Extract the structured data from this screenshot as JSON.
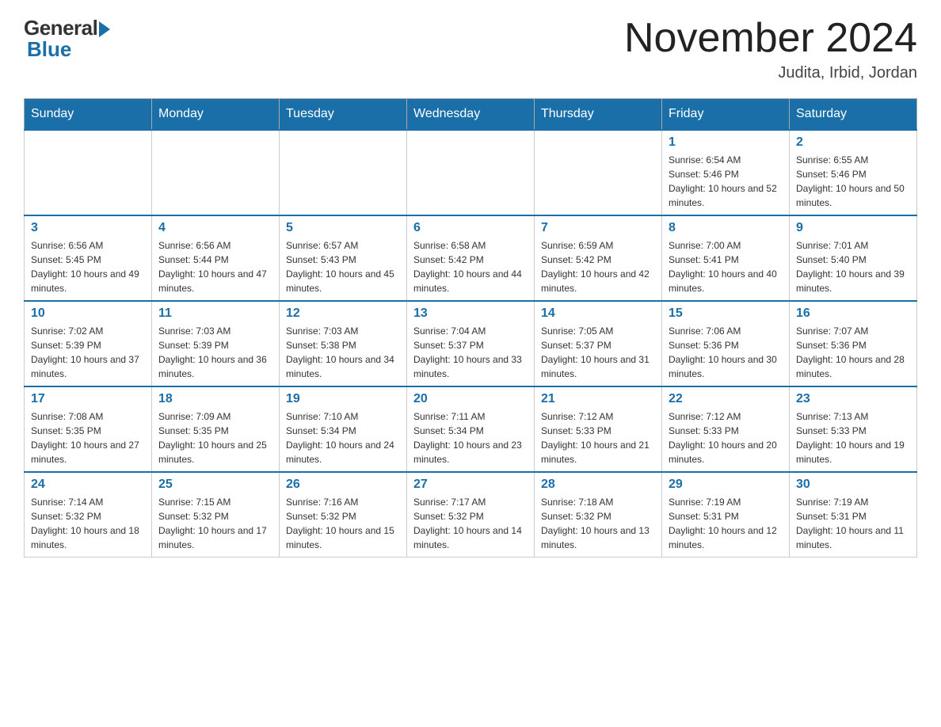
{
  "header": {
    "logo_general": "General",
    "logo_blue": "Blue",
    "month_title": "November 2024",
    "location": "Judita, Irbid, Jordan"
  },
  "weekdays": [
    "Sunday",
    "Monday",
    "Tuesday",
    "Wednesday",
    "Thursday",
    "Friday",
    "Saturday"
  ],
  "weeks": [
    [
      {
        "day": "",
        "sunrise": "",
        "sunset": "",
        "daylight": ""
      },
      {
        "day": "",
        "sunrise": "",
        "sunset": "",
        "daylight": ""
      },
      {
        "day": "",
        "sunrise": "",
        "sunset": "",
        "daylight": ""
      },
      {
        "day": "",
        "sunrise": "",
        "sunset": "",
        "daylight": ""
      },
      {
        "day": "",
        "sunrise": "",
        "sunset": "",
        "daylight": ""
      },
      {
        "day": "1",
        "sunrise": "Sunrise: 6:54 AM",
        "sunset": "Sunset: 5:46 PM",
        "daylight": "Daylight: 10 hours and 52 minutes."
      },
      {
        "day": "2",
        "sunrise": "Sunrise: 6:55 AM",
        "sunset": "Sunset: 5:46 PM",
        "daylight": "Daylight: 10 hours and 50 minutes."
      }
    ],
    [
      {
        "day": "3",
        "sunrise": "Sunrise: 6:56 AM",
        "sunset": "Sunset: 5:45 PM",
        "daylight": "Daylight: 10 hours and 49 minutes."
      },
      {
        "day": "4",
        "sunrise": "Sunrise: 6:56 AM",
        "sunset": "Sunset: 5:44 PM",
        "daylight": "Daylight: 10 hours and 47 minutes."
      },
      {
        "day": "5",
        "sunrise": "Sunrise: 6:57 AM",
        "sunset": "Sunset: 5:43 PM",
        "daylight": "Daylight: 10 hours and 45 minutes."
      },
      {
        "day": "6",
        "sunrise": "Sunrise: 6:58 AM",
        "sunset": "Sunset: 5:42 PM",
        "daylight": "Daylight: 10 hours and 44 minutes."
      },
      {
        "day": "7",
        "sunrise": "Sunrise: 6:59 AM",
        "sunset": "Sunset: 5:42 PM",
        "daylight": "Daylight: 10 hours and 42 minutes."
      },
      {
        "day": "8",
        "sunrise": "Sunrise: 7:00 AM",
        "sunset": "Sunset: 5:41 PM",
        "daylight": "Daylight: 10 hours and 40 minutes."
      },
      {
        "day": "9",
        "sunrise": "Sunrise: 7:01 AM",
        "sunset": "Sunset: 5:40 PM",
        "daylight": "Daylight: 10 hours and 39 minutes."
      }
    ],
    [
      {
        "day": "10",
        "sunrise": "Sunrise: 7:02 AM",
        "sunset": "Sunset: 5:39 PM",
        "daylight": "Daylight: 10 hours and 37 minutes."
      },
      {
        "day": "11",
        "sunrise": "Sunrise: 7:03 AM",
        "sunset": "Sunset: 5:39 PM",
        "daylight": "Daylight: 10 hours and 36 minutes."
      },
      {
        "day": "12",
        "sunrise": "Sunrise: 7:03 AM",
        "sunset": "Sunset: 5:38 PM",
        "daylight": "Daylight: 10 hours and 34 minutes."
      },
      {
        "day": "13",
        "sunrise": "Sunrise: 7:04 AM",
        "sunset": "Sunset: 5:37 PM",
        "daylight": "Daylight: 10 hours and 33 minutes."
      },
      {
        "day": "14",
        "sunrise": "Sunrise: 7:05 AM",
        "sunset": "Sunset: 5:37 PM",
        "daylight": "Daylight: 10 hours and 31 minutes."
      },
      {
        "day": "15",
        "sunrise": "Sunrise: 7:06 AM",
        "sunset": "Sunset: 5:36 PM",
        "daylight": "Daylight: 10 hours and 30 minutes."
      },
      {
        "day": "16",
        "sunrise": "Sunrise: 7:07 AM",
        "sunset": "Sunset: 5:36 PM",
        "daylight": "Daylight: 10 hours and 28 minutes."
      }
    ],
    [
      {
        "day": "17",
        "sunrise": "Sunrise: 7:08 AM",
        "sunset": "Sunset: 5:35 PM",
        "daylight": "Daylight: 10 hours and 27 minutes."
      },
      {
        "day": "18",
        "sunrise": "Sunrise: 7:09 AM",
        "sunset": "Sunset: 5:35 PM",
        "daylight": "Daylight: 10 hours and 25 minutes."
      },
      {
        "day": "19",
        "sunrise": "Sunrise: 7:10 AM",
        "sunset": "Sunset: 5:34 PM",
        "daylight": "Daylight: 10 hours and 24 minutes."
      },
      {
        "day": "20",
        "sunrise": "Sunrise: 7:11 AM",
        "sunset": "Sunset: 5:34 PM",
        "daylight": "Daylight: 10 hours and 23 minutes."
      },
      {
        "day": "21",
        "sunrise": "Sunrise: 7:12 AM",
        "sunset": "Sunset: 5:33 PM",
        "daylight": "Daylight: 10 hours and 21 minutes."
      },
      {
        "day": "22",
        "sunrise": "Sunrise: 7:12 AM",
        "sunset": "Sunset: 5:33 PM",
        "daylight": "Daylight: 10 hours and 20 minutes."
      },
      {
        "day": "23",
        "sunrise": "Sunrise: 7:13 AM",
        "sunset": "Sunset: 5:33 PM",
        "daylight": "Daylight: 10 hours and 19 minutes."
      }
    ],
    [
      {
        "day": "24",
        "sunrise": "Sunrise: 7:14 AM",
        "sunset": "Sunset: 5:32 PM",
        "daylight": "Daylight: 10 hours and 18 minutes."
      },
      {
        "day": "25",
        "sunrise": "Sunrise: 7:15 AM",
        "sunset": "Sunset: 5:32 PM",
        "daylight": "Daylight: 10 hours and 17 minutes."
      },
      {
        "day": "26",
        "sunrise": "Sunrise: 7:16 AM",
        "sunset": "Sunset: 5:32 PM",
        "daylight": "Daylight: 10 hours and 15 minutes."
      },
      {
        "day": "27",
        "sunrise": "Sunrise: 7:17 AM",
        "sunset": "Sunset: 5:32 PM",
        "daylight": "Daylight: 10 hours and 14 minutes."
      },
      {
        "day": "28",
        "sunrise": "Sunrise: 7:18 AM",
        "sunset": "Sunset: 5:32 PM",
        "daylight": "Daylight: 10 hours and 13 minutes."
      },
      {
        "day": "29",
        "sunrise": "Sunrise: 7:19 AM",
        "sunset": "Sunset: 5:31 PM",
        "daylight": "Daylight: 10 hours and 12 minutes."
      },
      {
        "day": "30",
        "sunrise": "Sunrise: 7:19 AM",
        "sunset": "Sunset: 5:31 PM",
        "daylight": "Daylight: 10 hours and 11 minutes."
      }
    ]
  ]
}
